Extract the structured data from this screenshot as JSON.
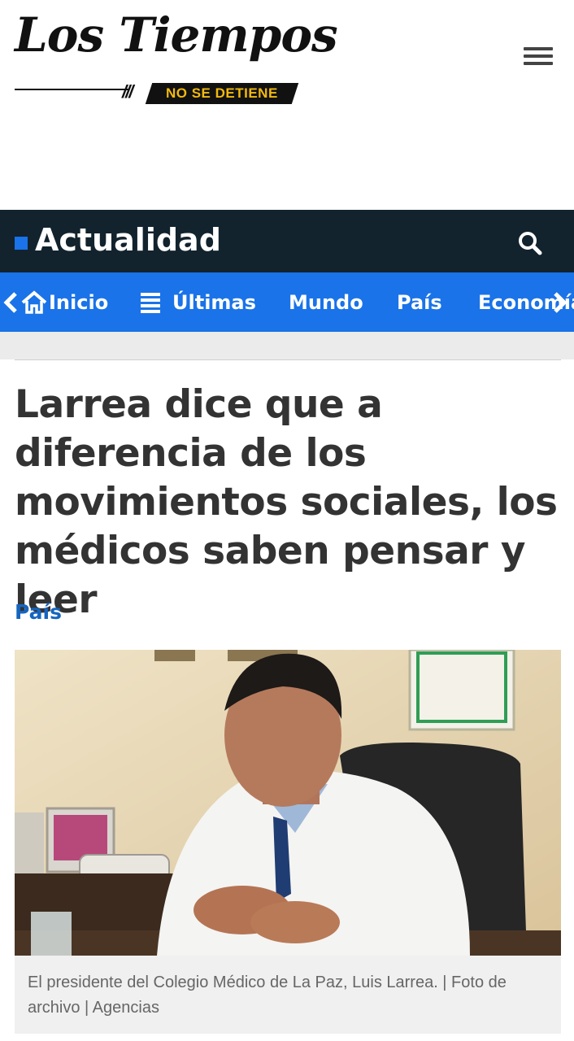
{
  "header": {
    "logo_title": "Los Tiempos",
    "logo_tagline": "NO SE DETIENE",
    "menu_icon": "hamburger-menu-icon"
  },
  "section": {
    "title": "Actualidad",
    "search_icon": "search-icon"
  },
  "nav": {
    "items": [
      {
        "label": "Inicio",
        "icon": "home-icon"
      },
      {
        "label": "Últimas",
        "icon": "list-icon"
      },
      {
        "label": "Mundo"
      },
      {
        "label": "País"
      },
      {
        "label": "Economía"
      }
    ],
    "prev_icon": "chevron-left-icon",
    "next_icon": "chevron-right-icon"
  },
  "article": {
    "headline": "Larrea dice que a diferencia de los movimientos sociales, los médicos saben pensar y leer",
    "category": "País",
    "caption": "El presidente del Colegio Médico de La Paz, Luis Larrea. | Foto de archivo | Agencias"
  },
  "colors": {
    "section_bar": "#12232e",
    "nav_bar": "#1a73e8",
    "accent": "#1a73e8",
    "category_link": "#1565c0",
    "tagline": "#f2b90f"
  }
}
